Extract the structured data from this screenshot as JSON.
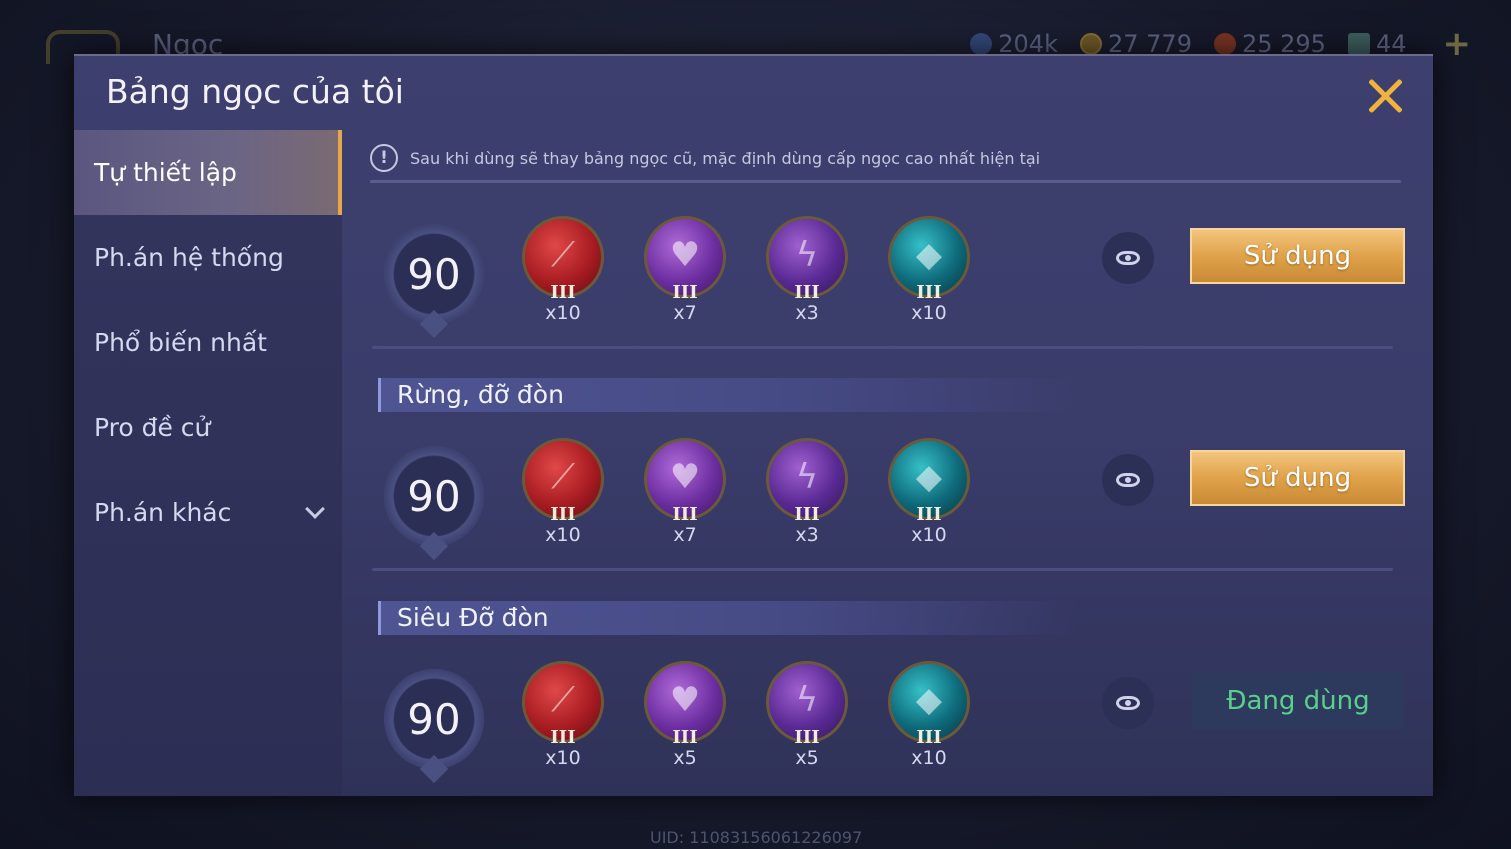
{
  "background": {
    "title": "Ngọc",
    "currencies": [
      {
        "icon": "diamond-icon",
        "value": "204k",
        "color": "#4a6bb8"
      },
      {
        "icon": "gold-coin-icon",
        "value": "27 779",
        "color": "#b8882a"
      },
      {
        "icon": "ruby-icon",
        "value": "25 295",
        "color": "#b84a2a"
      },
      {
        "icon": "voucher-icon",
        "value": "44",
        "color": "#4a8a8a"
      }
    ],
    "uid": "UID: 11083156061226097"
  },
  "dialog": {
    "title": "Bảng ngọc của tôi",
    "notice": "Sau khi dùng sẽ thay bảng ngọc cũ, mặc định dùng cấp ngọc cao nhất hiện tại",
    "notice_icon": "!"
  },
  "sidebar": {
    "items": [
      {
        "label": "Tự thiết lập",
        "active": true
      },
      {
        "label": "Ph.án hệ thống",
        "active": false
      },
      {
        "label": "Phổ biến nhất",
        "active": false
      },
      {
        "label": "Pro đề cử",
        "active": false
      },
      {
        "label": "Ph.án khác",
        "active": false,
        "has_chevron": true
      }
    ]
  },
  "rune_pages": [
    {
      "name": "",
      "level": "90",
      "gems": [
        {
          "color": "red",
          "tier": "III",
          "count": "x10"
        },
        {
          "color": "purple",
          "tier": "III",
          "count": "x7"
        },
        {
          "color": "violet",
          "tier": "III",
          "count": "x3"
        },
        {
          "color": "teal",
          "tier": "III",
          "count": "x10"
        }
      ],
      "button": "Sử dụng"
    },
    {
      "name": "Rừng, đỡ đòn",
      "level": "90",
      "gems": [
        {
          "color": "red",
          "tier": "III",
          "count": "x10"
        },
        {
          "color": "purple",
          "tier": "III",
          "count": "x7"
        },
        {
          "color": "violet",
          "tier": "III",
          "count": "x3"
        },
        {
          "color": "teal",
          "tier": "III",
          "count": "x10"
        }
      ],
      "button": "Sử dụng"
    },
    {
      "name": "Siêu Đỡ đòn",
      "level": "90",
      "gems": [
        {
          "color": "red",
          "tier": "III",
          "count": "x10"
        },
        {
          "color": "purple",
          "tier": "III",
          "count": "x5"
        },
        {
          "color": "violet",
          "tier": "III",
          "count": "x5"
        },
        {
          "color": "teal",
          "tier": "III",
          "count": "x10"
        }
      ],
      "button": "Đang dùng"
    }
  ],
  "colors": {
    "accent_gold": "#e0a24a",
    "close_x": "#f2b33c",
    "in_use_green": "#58d08c"
  }
}
